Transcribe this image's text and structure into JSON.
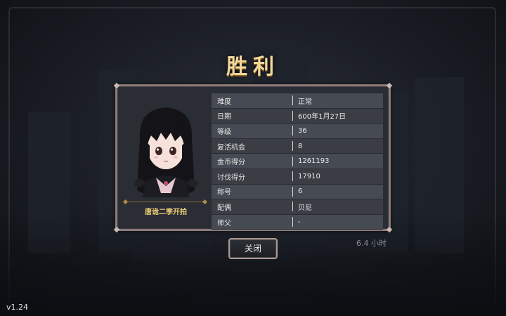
{
  "title": "胜利",
  "character": {
    "caption": "唐诡二季开拍"
  },
  "stats": [
    {
      "label": "难度",
      "value": "正常"
    },
    {
      "label": "日期",
      "value": "600年1月27日"
    },
    {
      "label": "等级",
      "value": "36"
    },
    {
      "label": "复活机会",
      "value": "8"
    },
    {
      "label": "金币得分",
      "value": "1261193"
    },
    {
      "label": "讨伐得分",
      "value": "17910"
    },
    {
      "label": "称号",
      "value": "6"
    },
    {
      "label": "配偶",
      "value": "贝尼"
    },
    {
      "label": "师父",
      "value": "-"
    }
  ],
  "close_label": "关闭",
  "playtime": "6.4 小时",
  "version": "v1.24",
  "colors": {
    "title_gold": "#f3d79a",
    "caption_gold": "#f0cf78",
    "panel_bg": "#2a2d34",
    "row_odd": "#464a52",
    "row_even": "#3a3d44"
  }
}
